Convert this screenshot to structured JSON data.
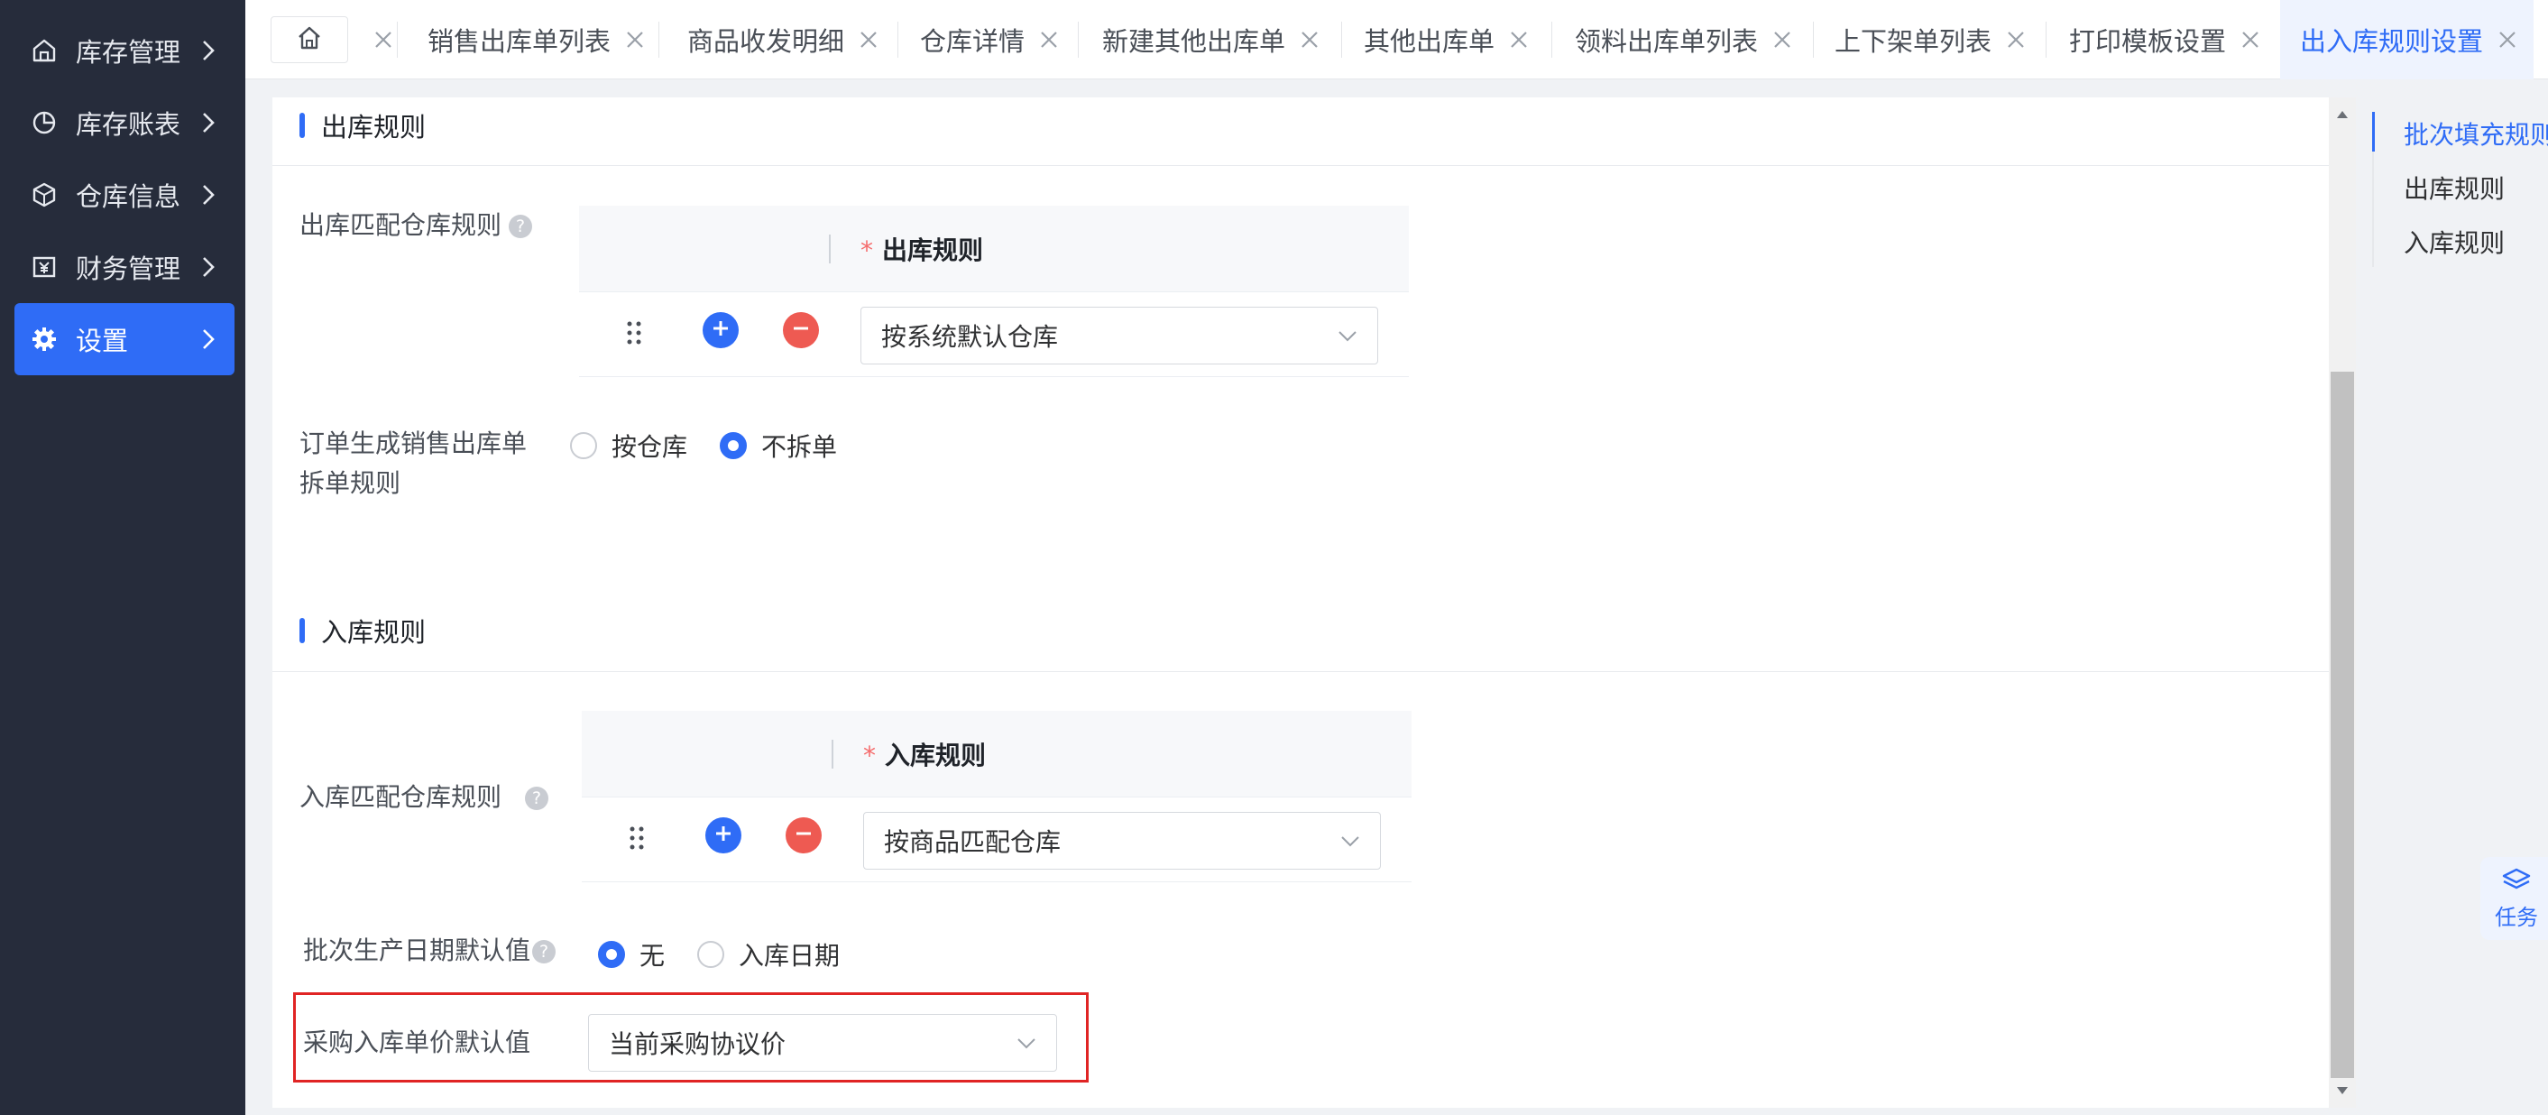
{
  "sidebar": {
    "items": [
      {
        "label": "库存管理",
        "icon": "home-icon",
        "active": false
      },
      {
        "label": "库存账表",
        "icon": "pie-chart-icon",
        "active": false
      },
      {
        "label": "仓库信息",
        "icon": "cube-icon",
        "active": false
      },
      {
        "label": "财务管理",
        "icon": "finance-icon",
        "active": false
      },
      {
        "label": "设置",
        "icon": "gear-icon",
        "active": true
      }
    ]
  },
  "tabs": [
    {
      "label": "销售出库单列表",
      "active": false
    },
    {
      "label": "商品收发明细",
      "active": false
    },
    {
      "label": "仓库详情",
      "active": false
    },
    {
      "label": "新建其他出库单",
      "active": false
    },
    {
      "label": "其他出库单",
      "active": false
    },
    {
      "label": "领料出库单列表",
      "active": false
    },
    {
      "label": "上下架单列表",
      "active": false
    },
    {
      "label": "打印模板设置",
      "active": false
    },
    {
      "label": "出入库规则设置",
      "active": true
    }
  ],
  "outbound": {
    "section_title": "出库规则",
    "match_rule_label": "出库匹配仓库规则",
    "table_header": "出库规则",
    "required_mark": "*",
    "selected_rule": "按系统默认仓库",
    "split_rule_label_line1": "订单生成销售出库单",
    "split_rule_label_line2": "拆单规则",
    "split_options": [
      {
        "label": "按仓库",
        "checked": false
      },
      {
        "label": "不拆单",
        "checked": true
      }
    ]
  },
  "inbound": {
    "section_title": "入库规则",
    "match_rule_label": "入库匹配仓库规则",
    "table_header": "入库规则",
    "required_mark": "*",
    "selected_rule": "按商品匹配仓库",
    "batch_date_label": "批次生产日期默认值",
    "batch_date_options": [
      {
        "label": "无",
        "checked": true
      },
      {
        "label": "入库日期",
        "checked": false
      }
    ],
    "purchase_price_label": "采购入库单价默认值",
    "purchase_price_value": "当前采购协议价"
  },
  "anchor_nav": {
    "items": [
      {
        "label": "批次填充规则",
        "active": true
      },
      {
        "label": "出库规则",
        "active": false
      },
      {
        "label": "入库规则",
        "active": false
      }
    ]
  },
  "task_float": {
    "label": "任务",
    "icon": "layers-icon"
  },
  "help_glyph": "?",
  "colors": {
    "accent": "#2f6cf6",
    "sidebar_bg": "#262c3b",
    "danger": "#ee5a52",
    "highlight": "#e02424"
  }
}
